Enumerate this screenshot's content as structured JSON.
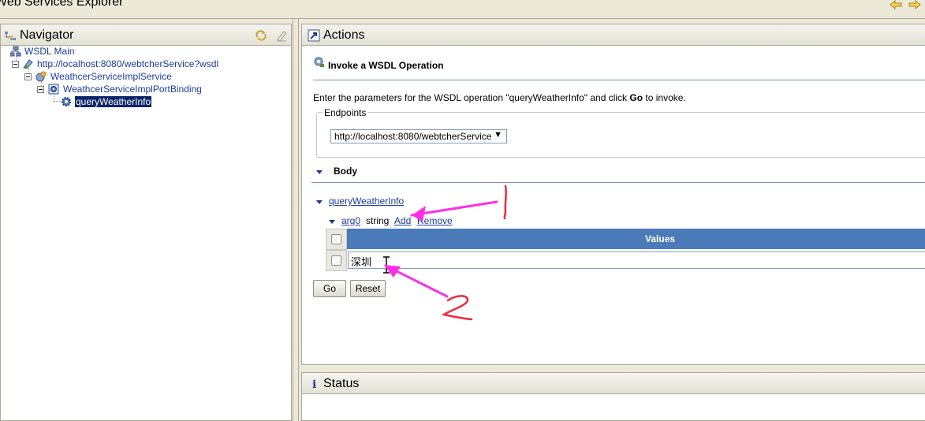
{
  "window": {
    "title": "Web Services Explorer",
    "back_icon": "back-arrow-icon",
    "forward_icon": "forward-arrow-icon"
  },
  "navigator": {
    "title": "Navigator",
    "tree": [
      {
        "label": "WSDL Main",
        "icon": "wsdl-main-icon",
        "depth": 0
      },
      {
        "label": "http://localhost:8080/webtcherService?wsdl",
        "icon": "wsdl-file-icon",
        "depth": 1
      },
      {
        "label": "WeathcerServiceImplService",
        "icon": "service-icon",
        "depth": 2
      },
      {
        "label": "WeathcerServiceImplPortBinding",
        "icon": "binding-icon",
        "depth": 3
      },
      {
        "label": "queryWeatherInfo",
        "icon": "operation-gear-icon",
        "depth": 4,
        "selected": true
      }
    ]
  },
  "actions": {
    "title": "Actions",
    "section_title": "Invoke a WSDL Operation",
    "instructions_prefix": "Enter the parameters for the WSDL operation \"queryWeatherInfo\" and click ",
    "instructions_go": "Go",
    "instructions_suffix": " to invoke.",
    "endpoints_legend": "Endpoints",
    "endpoint_selected": "http://localhost:8080/webtcherService",
    "body_label": "Body",
    "operation_link": "queryWeatherInfo",
    "arg_name": "arg0",
    "arg_type": "string",
    "add_link": "Add",
    "remove_link": "Remove",
    "values_header": "Values",
    "value_input": "深圳",
    "go_button": "Go",
    "reset_button": "Reset"
  },
  "status": {
    "title": "Status"
  },
  "annotations": {
    "label_1": "1",
    "label_2": "2",
    "arrow_color": "#ff2ee6",
    "scribble_color": "#f0283c"
  }
}
